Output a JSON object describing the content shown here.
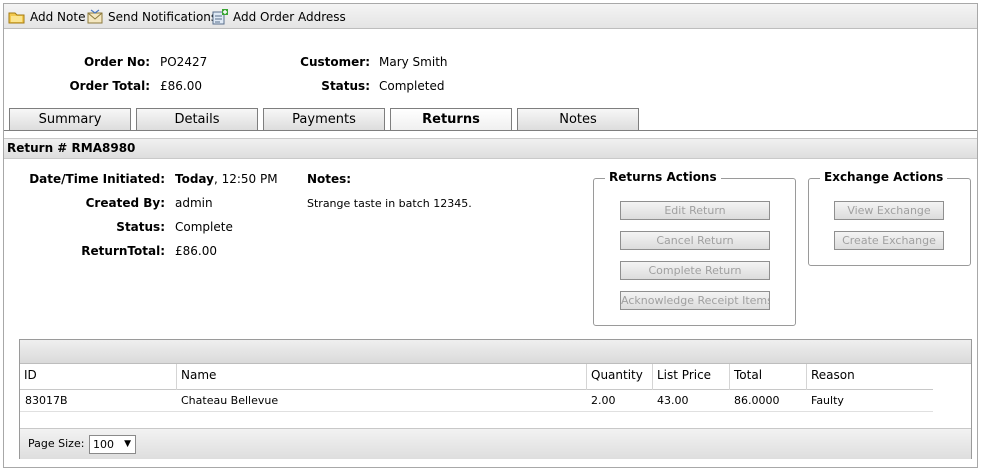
{
  "toolbar": {
    "add_note": "Add Note",
    "send_notifications": "Send Notifications",
    "add_order_address": "Add Order Address"
  },
  "order": {
    "order_no_label": "Order No:",
    "order_no": "PO2427",
    "order_total_label": "Order Total:",
    "order_total": "£86.00",
    "customer_label": "Customer:",
    "customer": "Mary Smith",
    "status_label": "Status:",
    "status": "Completed"
  },
  "tabs": [
    {
      "label": "Summary"
    },
    {
      "label": "Details"
    },
    {
      "label": "Payments"
    },
    {
      "label": "Returns",
      "active": true
    },
    {
      "label": "Notes"
    }
  ],
  "return": {
    "title": "Return # RMA8980",
    "datetime_label": "Date/Time Initiated:",
    "datetime_day": "Today",
    "datetime_time": ", 12:50 PM",
    "created_by_label": "Created By:",
    "created_by": "admin",
    "status_label": "Status:",
    "status": "Complete",
    "total_label": "ReturnTotal:",
    "total": "£86.00",
    "notes_label": "Notes:",
    "notes": "Strange taste in batch 12345."
  },
  "returns_actions": {
    "legend": "Returns Actions",
    "edit": "Edit Return",
    "cancel": "Cancel Return",
    "complete": "Complete Return",
    "acknowledge": "Acknowledge Receipt Items"
  },
  "exchange_actions": {
    "legend": "Exchange Actions",
    "view": "View Exchange",
    "create": "Create Exchange"
  },
  "grid": {
    "columns": [
      "ID",
      "Name",
      "Quantity",
      "List Price",
      "Total",
      "Reason"
    ],
    "rows": [
      {
        "id": "83017B",
        "name": "Chateau Bellevue",
        "quantity": "2.00",
        "list_price": "43.00",
        "total": "86.0000",
        "reason": "Faulty"
      }
    ],
    "page_size_label": "Page Size:",
    "page_size": "100"
  }
}
